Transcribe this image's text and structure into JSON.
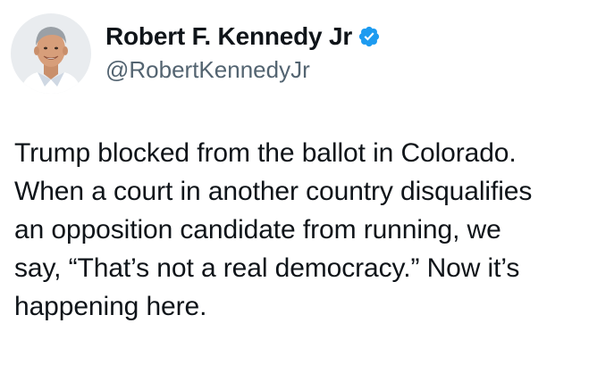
{
  "tweet": {
    "author": {
      "display_name": "Robert F. Kennedy Jr",
      "handle": "@RobertKennedyJr",
      "verified": true,
      "verified_color": "#1d9bf0",
      "avatar_icon": "profile-photo"
    },
    "text_lines": [
      "Trump blocked from the ballot in Colorado.",
      "When a court in another country disqualifies",
      "an opposition candidate from running, we",
      "say, “That’s not a real democracy.” Now it’s",
      "happening here."
    ]
  }
}
